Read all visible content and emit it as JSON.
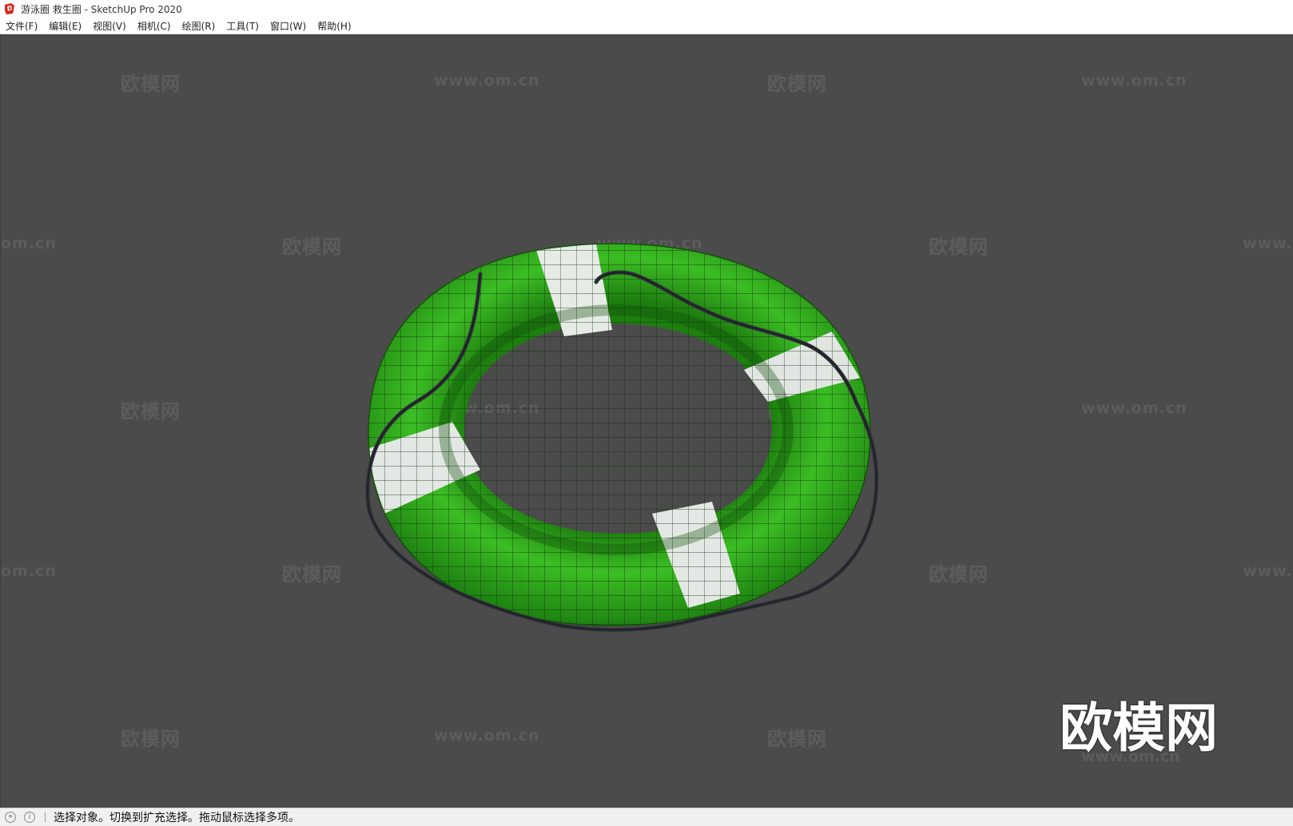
{
  "window": {
    "title": "游泳圈 救生圈 - SketchUp Pro 2020"
  },
  "menu": {
    "items": [
      {
        "label": "文件(F)"
      },
      {
        "label": "编辑(E)"
      },
      {
        "label": "视图(V)"
      },
      {
        "label": "相机(C)"
      },
      {
        "label": "绘图(R)"
      },
      {
        "label": "工具(T)"
      },
      {
        "label": "窗口(W)"
      },
      {
        "label": "帮助(H)"
      }
    ]
  },
  "viewport": {
    "background_color": "#4b4b4b",
    "model": "green-lifebuoy-with-white-stripes-and-rope",
    "watermark_text": "欧模网",
    "watermark_url": "www.om.cn",
    "watermark_partial_left": "om.cn",
    "watermark_partial_right": "www."
  },
  "status": {
    "icons": [
      "geo-location-icon",
      "info-icon"
    ],
    "message": "选择对象。切换到扩充选择。拖动鼠标选择多项。"
  },
  "colors": {
    "buoy_green": "#2fa21a",
    "stripe_white": "#e8e8e8",
    "rope": "#2e3138",
    "app_icon_red": "#d9261c"
  }
}
